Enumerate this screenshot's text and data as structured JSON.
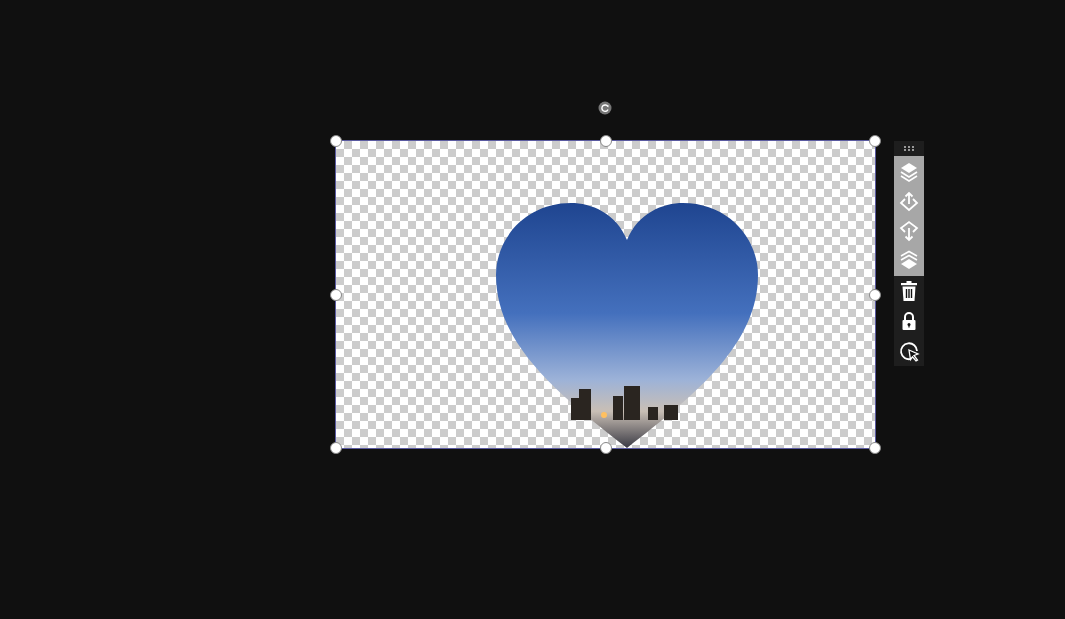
{
  "selection": {
    "selected": true
  },
  "toolbar": {
    "tools": [
      {
        "kind": "bring-to-front",
        "highlighted": true
      },
      {
        "kind": "bring-forward",
        "highlighted": true
      },
      {
        "kind": "send-backward",
        "highlighted": true
      },
      {
        "kind": "send-to-back",
        "highlighted": true
      },
      {
        "kind": "delete",
        "highlighted": false
      },
      {
        "kind": "lock",
        "highlighted": false
      },
      {
        "kind": "select-pointer",
        "highlighted": false
      }
    ]
  }
}
